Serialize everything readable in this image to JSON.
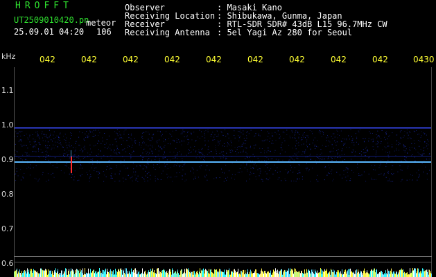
{
  "header": {
    "logo": "HROFFT",
    "filename": "UT2509010420.pn",
    "meteor_label": "meteor",
    "datetime": "25.09.01 04:20",
    "count": "106",
    "info_labels": [
      "Observer",
      "Receiving Location",
      "Receiver",
      "Receiving Antenna"
    ],
    "info_values": [
      ": Masaki Kano",
      ": Shibukawa, Gunma, Japan",
      ": RTL-SDR SDR# 43dB L15 96.7MHz CW",
      ": 5el Yagi Az 280 for Seoul"
    ]
  },
  "axis": {
    "unit": "kHz",
    "y_labels": [
      "1.1",
      "1.0",
      "0.9",
      "0.8",
      "0.7",
      "0.6"
    ],
    "time_ticks": [
      "042",
      "042",
      "042",
      "042",
      "042",
      "042",
      "042",
      "042",
      "042",
      "0430"
    ]
  },
  "colors": {
    "carrier": "#5ab8ff",
    "upper_line": "#3a4cff",
    "noise": "#1a2aa8",
    "meteor": "#ff2a2a",
    "guide": "#888888"
  }
}
